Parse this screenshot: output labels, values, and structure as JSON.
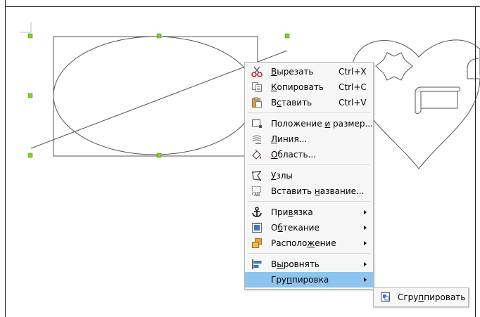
{
  "context_menu": {
    "groups": [
      [
        {
          "id": "cut",
          "icon": "scissors-icon",
          "pre": "",
          "u": "В",
          "post": "ырезать",
          "shortcut": "Ctrl+X"
        },
        {
          "id": "copy",
          "icon": "copy-icon",
          "pre": "",
          "u": "К",
          "post": "опировать",
          "shortcut": "Ctrl+C"
        },
        {
          "id": "paste",
          "icon": "paste-icon",
          "pre": "В",
          "u": "с",
          "post": "тавить",
          "shortcut": "Ctrl+V"
        }
      ],
      [
        {
          "id": "position-size",
          "icon": "position-size-icon",
          "pre": "Положение ",
          "u": "и",
          "post": " размер...",
          "shortcut": ""
        },
        {
          "id": "line",
          "icon": "line-style-icon",
          "pre": "",
          "u": "Л",
          "post": "иния...",
          "shortcut": ""
        },
        {
          "id": "area",
          "icon": "area-fill-icon",
          "pre": "",
          "u": "О",
          "post": "бласть...",
          "shortcut": ""
        }
      ],
      [
        {
          "id": "points",
          "icon": "points-icon",
          "pre": "",
          "u": "У",
          "post": "злы",
          "shortcut": ""
        },
        {
          "id": "insert-caption",
          "icon": "insert-caption-icon",
          "pre": "Вставить ",
          "u": "н",
          "post": "азвание...",
          "shortcut": ""
        }
      ],
      [
        {
          "id": "anchor",
          "icon": "anchor-icon",
          "pre": "При",
          "u": "в",
          "post": "язка",
          "shortcut": "",
          "submenu": true
        },
        {
          "id": "wrap",
          "icon": "wrap-icon",
          "pre": "О",
          "u": "б",
          "post": "текание",
          "shortcut": "",
          "submenu": true
        },
        {
          "id": "arrange",
          "icon": "arrange-icon",
          "pre": "Располо",
          "u": "ж",
          "post": "ение",
          "shortcut": "",
          "submenu": true
        }
      ],
      [
        {
          "id": "align",
          "icon": "align-icon",
          "pre": "В",
          "u": "ы",
          "post": "ровнять",
          "shortcut": "",
          "submenu": true
        },
        {
          "id": "group",
          "icon": "",
          "pre": "Гру",
          "u": "п",
          "post": "пировка",
          "shortcut": "",
          "submenu": true,
          "active": true
        }
      ]
    ]
  },
  "submenu": {
    "items": [
      {
        "id": "group-objects",
        "icon": "group-icon",
        "pre": "Сгру",
        "u": "п",
        "post": "пировать"
      }
    ]
  },
  "colors": {
    "menu_bg": "#f7f7f7",
    "highlight": "#8ec5ee",
    "handle_green": "#7ed321",
    "shape_stroke": "#555555"
  }
}
